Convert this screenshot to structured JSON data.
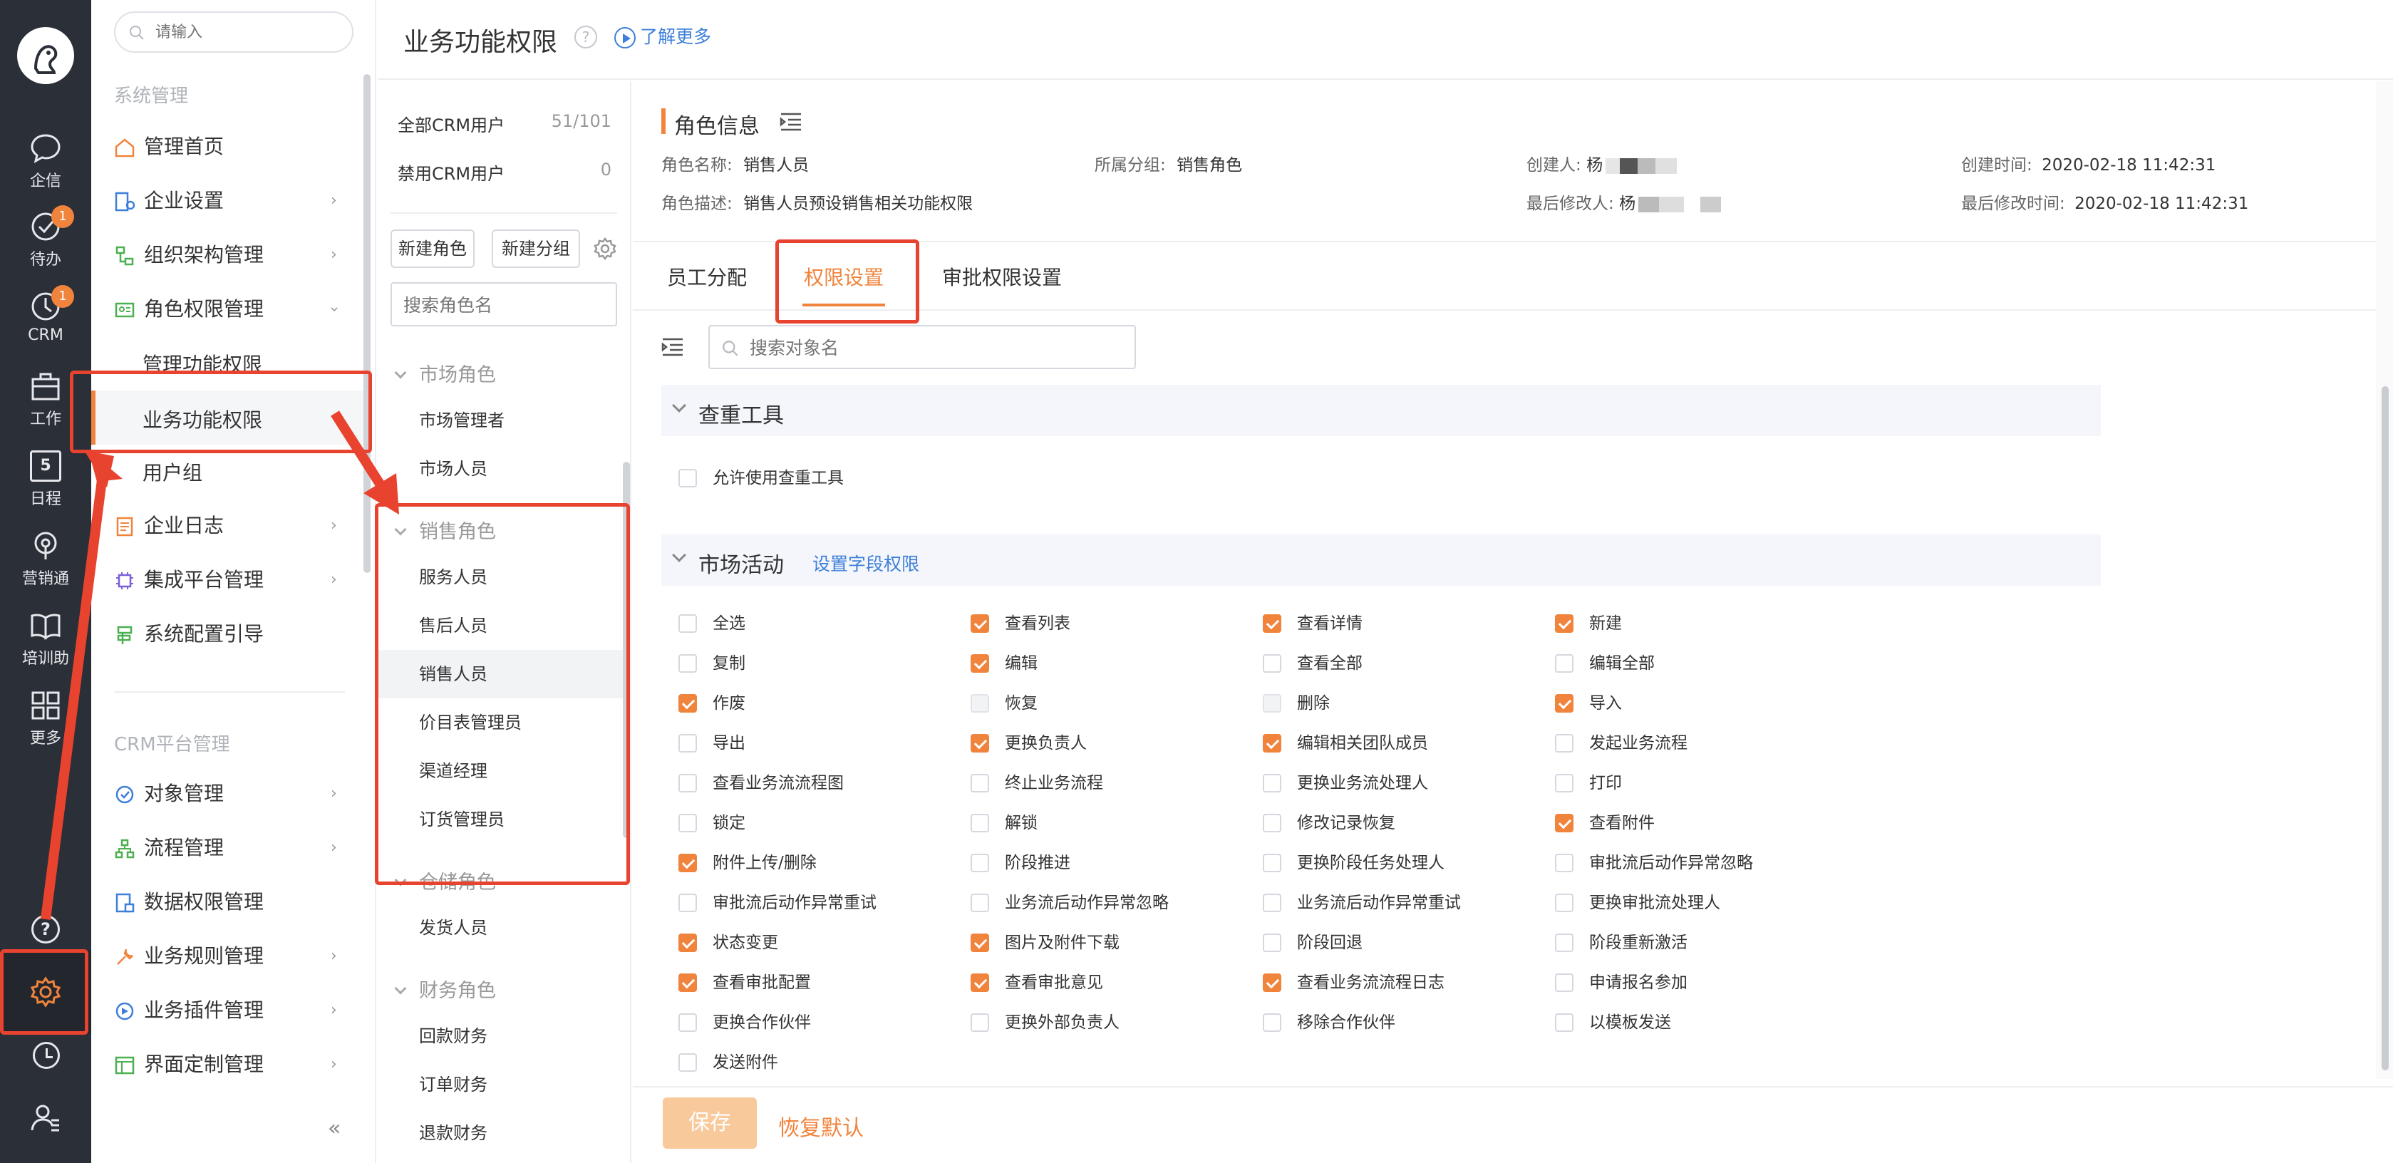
{
  "header": {
    "title": "业务功能权限",
    "learn_more": "了解更多"
  },
  "rail": {
    "items": [
      {
        "label": "企信",
        "icon": "chat-bubble-icon"
      },
      {
        "label": "待办",
        "icon": "check-circle-icon",
        "badge": "1"
      },
      {
        "label": "CRM",
        "icon": "clock-icon",
        "badge": "1"
      },
      {
        "label": "工作",
        "icon": "briefcase-icon"
      },
      {
        "label": "日程",
        "icon": "calendar-icon",
        "day": "5"
      },
      {
        "label": "营销通",
        "icon": "broadcast-icon"
      },
      {
        "label": "培训助",
        "icon": "book-icon"
      },
      {
        "label": "更多",
        "icon": "grid-icon"
      }
    ]
  },
  "menu": {
    "search_placeholder": "请输入",
    "group1": "系统管理",
    "items1": [
      {
        "label": "管理首页",
        "icon": "home-icon"
      },
      {
        "label": "企业设置",
        "icon": "building-icon"
      },
      {
        "label": "组织架构管理",
        "icon": "org-chart-icon"
      },
      {
        "label": "角色权限管理",
        "icon": "id-card-icon"
      }
    ],
    "sub": [
      "管理功能权限",
      "业务功能权限",
      "用户组"
    ],
    "items2": [
      {
        "label": "企业日志",
        "icon": "log-icon"
      },
      {
        "label": "集成平台管理",
        "icon": "chip-icon"
      },
      {
        "label": "系统配置引导",
        "icon": "guide-icon"
      }
    ],
    "group2": "CRM平台管理",
    "items3": [
      {
        "label": "对象管理",
        "icon": "object-icon"
      },
      {
        "label": "流程管理",
        "icon": "flow-icon"
      },
      {
        "label": "数据权限管理",
        "icon": "data-lock-icon"
      },
      {
        "label": "业务规则管理",
        "icon": "wrench-icon"
      },
      {
        "label": "业务插件管理",
        "icon": "plugin-icon"
      },
      {
        "label": "界面定制管理",
        "icon": "layout-icon"
      }
    ],
    "collapse": "«"
  },
  "roles": {
    "all_users_label": "全部CRM用户",
    "all_users_count": "51/101",
    "disabled_users_label": "禁用CRM用户",
    "disabled_users_count": "0",
    "new_role": "新建角色",
    "new_group": "新建分组",
    "search_placeholder": "搜索角色名",
    "groups": [
      {
        "name": "市场角色",
        "roles": [
          "市场管理者",
          "市场人员"
        ]
      },
      {
        "name": "销售角色",
        "roles": [
          "服务人员",
          "售后人员",
          "销售人员",
          "价目表管理员",
          "渠道经理",
          "订货管理员"
        ]
      },
      {
        "name": "仓储角色",
        "roles": [
          "发货人员"
        ]
      },
      {
        "name": "财务角色",
        "roles": [
          "回款财务",
          "订单财务",
          "退款财务"
        ]
      }
    ],
    "selected": "销售人员"
  },
  "role_info": {
    "title": "角色信息",
    "name_label": "角色名称:",
    "name_value": "销售人员",
    "group_label": "所属分组:",
    "group_value": "销售角色",
    "creator_label": "创建人:",
    "creator_value": "杨",
    "created_label": "创建时间:",
    "created_value": "2020-02-18 11:42:31",
    "desc_label": "角色描述:",
    "desc_value": "销售人员预设销售相关功能权限",
    "modifier_label": "最后修改人:",
    "modifier_value": "杨",
    "modified_label": "最后修改时间:",
    "modified_value": "2020-02-18 11:42:31"
  },
  "tabs": [
    "员工分配",
    "权限设置",
    "审批权限设置"
  ],
  "active_tab": "权限设置",
  "object_search_placeholder": "搜索对象名",
  "section1": {
    "title": "查重工具",
    "perms": [
      {
        "label": "允许使用查重工具",
        "state": "off"
      }
    ]
  },
  "section2": {
    "title": "市场活动",
    "link": "设置字段权限",
    "perms": [
      {
        "label": "全选",
        "state": "off"
      },
      {
        "label": "查看列表",
        "state": "on"
      },
      {
        "label": "查看详情",
        "state": "on"
      },
      {
        "label": "新建",
        "state": "on"
      },
      {
        "label": "复制",
        "state": "off"
      },
      {
        "label": "编辑",
        "state": "on"
      },
      {
        "label": "查看全部",
        "state": "off"
      },
      {
        "label": "编辑全部",
        "state": "off"
      },
      {
        "label": "作废",
        "state": "on"
      },
      {
        "label": "恢复",
        "state": "disabled"
      },
      {
        "label": "删除",
        "state": "disabled"
      },
      {
        "label": "导入",
        "state": "on"
      },
      {
        "label": "导出",
        "state": "off"
      },
      {
        "label": "更换负责人",
        "state": "on"
      },
      {
        "label": "编辑相关团队成员",
        "state": "on"
      },
      {
        "label": "发起业务流程",
        "state": "off"
      },
      {
        "label": "查看业务流流程图",
        "state": "off"
      },
      {
        "label": "终止业务流程",
        "state": "off"
      },
      {
        "label": "更换业务流处理人",
        "state": "off"
      },
      {
        "label": "打印",
        "state": "off"
      },
      {
        "label": "锁定",
        "state": "off"
      },
      {
        "label": "解锁",
        "state": "off"
      },
      {
        "label": "修改记录恢复",
        "state": "off"
      },
      {
        "label": "查看附件",
        "state": "on"
      },
      {
        "label": "附件上传/删除",
        "state": "on"
      },
      {
        "label": "阶段推进",
        "state": "off"
      },
      {
        "label": "更换阶段任务处理人",
        "state": "off"
      },
      {
        "label": "审批流后动作异常忽略",
        "state": "off"
      },
      {
        "label": "审批流后动作异常重试",
        "state": "off"
      },
      {
        "label": "业务流后动作异常忽略",
        "state": "off"
      },
      {
        "label": "业务流后动作异常重试",
        "state": "off"
      },
      {
        "label": "更换审批流处理人",
        "state": "off"
      },
      {
        "label": "状态变更",
        "state": "on"
      },
      {
        "label": "图片及附件下载",
        "state": "on"
      },
      {
        "label": "阶段回退",
        "state": "off"
      },
      {
        "label": "阶段重新激活",
        "state": "off"
      },
      {
        "label": "查看审批配置",
        "state": "on"
      },
      {
        "label": "查看审批意见",
        "state": "on"
      },
      {
        "label": "查看业务流流程日志",
        "state": "on"
      },
      {
        "label": "申请报名参加",
        "state": "off"
      },
      {
        "label": "更换合作伙伴",
        "state": "off"
      },
      {
        "label": "更换外部负责人",
        "state": "off"
      },
      {
        "label": "移除合作伙伴",
        "state": "off"
      },
      {
        "label": "以模板发送",
        "state": "off"
      },
      {
        "label": "发送附件",
        "state": "off"
      }
    ]
  },
  "footer": {
    "save": "保存",
    "reset": "恢复默认"
  },
  "colors": {
    "accent": "#f0843c",
    "rail_bg": "#2b2f38",
    "link": "#3d7fd9",
    "annotation": "#e8432f"
  }
}
